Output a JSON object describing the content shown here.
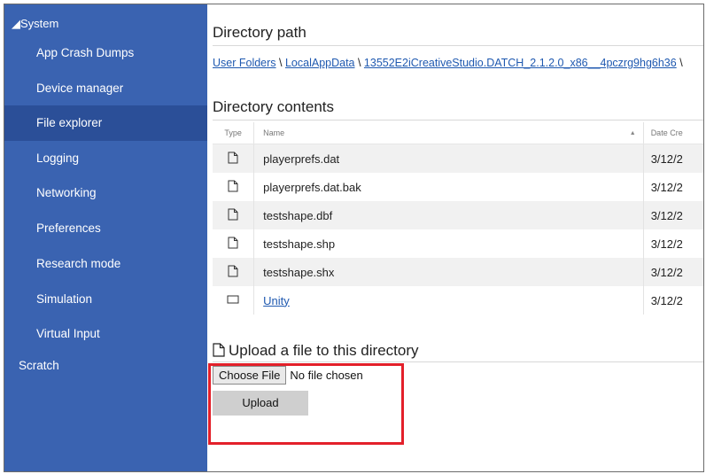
{
  "sidebar": {
    "section_label": "◢System",
    "items": [
      {
        "label": "App Crash Dumps",
        "active": false
      },
      {
        "label": "Device manager",
        "active": false
      },
      {
        "label": "File explorer",
        "active": true
      },
      {
        "label": "Logging",
        "active": false
      },
      {
        "label": "Networking",
        "active": false
      },
      {
        "label": "Preferences",
        "active": false
      },
      {
        "label": "Research mode",
        "active": false
      },
      {
        "label": "Simulation",
        "active": false
      },
      {
        "label": "Virtual Input",
        "active": false
      }
    ],
    "scratch_label": "Scratch"
  },
  "main": {
    "directory_path_heading": "Directory path",
    "breadcrumb": [
      {
        "label": "User Folders",
        "sep": " \\ "
      },
      {
        "label": "LocalAppData",
        "sep": " \\ "
      },
      {
        "label": "13552E2iCreativeStudio.DATCH_2.1.2.0_x86__4pczrg9hg6h36",
        "sep": " \\"
      }
    ],
    "directory_contents_heading": "Directory contents",
    "table": {
      "columns": [
        "Type",
        "Name",
        "Date Cre"
      ],
      "rows": [
        {
          "name": "playerprefs.dat",
          "date": "3/12/2",
          "kind": "file"
        },
        {
          "name": "playerprefs.dat.bak",
          "date": "3/12/2",
          "kind": "file"
        },
        {
          "name": "testshape.dbf",
          "date": "3/12/2",
          "kind": "file"
        },
        {
          "name": "testshape.shp",
          "date": "3/12/2",
          "kind": "file"
        },
        {
          "name": "testshape.shx",
          "date": "3/12/2",
          "kind": "file"
        },
        {
          "name": "Unity",
          "date": "3/12/2",
          "kind": "folder"
        }
      ]
    },
    "upload": {
      "heading": "Upload a file to this directory",
      "choose_file_label": "Choose File",
      "no_file_text": "No file chosen",
      "upload_button": "Upload"
    }
  },
  "colors": {
    "sidebar_bg": "#3a63b1",
    "sidebar_active": "#2b4f98",
    "link": "#1f59b0",
    "highlight_box": "#e3202a"
  }
}
